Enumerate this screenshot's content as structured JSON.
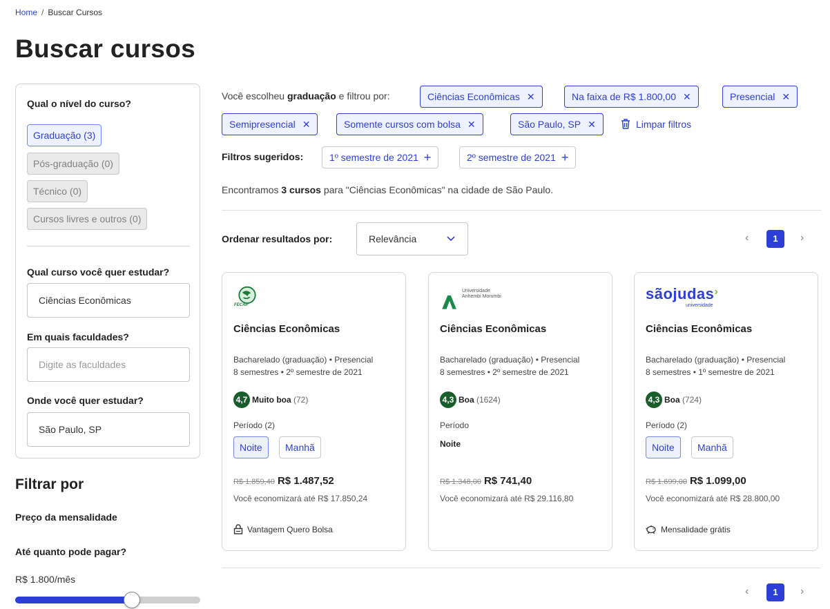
{
  "breadcrumb": {
    "home": "Home",
    "sep": "/",
    "current": "Buscar Cursos"
  },
  "page_title": "Buscar cursos",
  "sidebar": {
    "level_question": "Qual o nível do curso?",
    "levels": [
      {
        "label": "Graduação (3)",
        "active": true
      },
      {
        "label": "Pós-graduação (0)",
        "active": false
      },
      {
        "label": "Técnico (0)",
        "active": false
      },
      {
        "label": "Cursos livres e outros (0)",
        "active": false
      }
    ],
    "course_question": "Qual curso você quer estudar?",
    "course_value": "Ciências Econômicas",
    "faculty_question": "Em quais faculdades?",
    "faculty_placeholder": "Digite as faculdades",
    "location_question": "Onde você quer estudar?",
    "location_value": "São Paulo, SP"
  },
  "filters": {
    "title": "Filtrar por",
    "price_title": "Preço da mensalidade",
    "price_question": "Até quanto pode pagar?",
    "price_value": "R$ 1.800/mês",
    "price_slider_fraction": 0.63
  },
  "summary": {
    "prefix": "Você escolheu ",
    "level": "graduação",
    "suffix": " e filtrou por:",
    "chips": [
      "Ciências Econômicas",
      "Na faixa de R$ 1.800,00",
      "Presencial",
      "Semipresencial",
      "Somente cursos com bolsa",
      "São Paulo, SP"
    ],
    "clear_label": "Limpar filtros"
  },
  "suggested": {
    "label": "Filtros sugeridos:",
    "items": [
      "1º semestre de 2021",
      "2º semestre de 2021"
    ]
  },
  "found": {
    "prefix": "Encontramos ",
    "count": "3 cursos",
    "suffix": " para \"Ciências Econômicas\" na cidade de São Paulo."
  },
  "sort": {
    "label": "Ordenar resultados por:",
    "value": "Relevância"
  },
  "pagination": {
    "current": "1",
    "prev": "‹",
    "next": "›"
  },
  "cards": [
    {
      "logo": "fecap-logo",
      "logo_text": "FECAP",
      "name": "Ciências Econômicas",
      "desc1": "Bacharelado (graduação) • Presencial",
      "desc2": "8 semestres • 2º semestre de 2021",
      "score": "4,7",
      "rating_label": "Muito boa",
      "rating_count": "(72)",
      "period_label": "Período (2)",
      "periods": [
        "Noite",
        "Manhã"
      ],
      "old_price": "R$ 1.859,40",
      "price": "R$ 1.487,52",
      "savings": "Você economizará até R$ 17.850,24",
      "perk": "Vantagem Quero Bolsa",
      "perk_icon": "lock-icon"
    },
    {
      "logo": "anhembi-logo",
      "logo_text1": "Universidade",
      "logo_text2": "Anhembi Morumbi",
      "name": "Ciências Econômicas",
      "desc1": "Bacharelado (graduação) • Presencial",
      "desc2": "8 semestres • 2º semestre de 2021",
      "score": "4,3",
      "rating_label": "Boa",
      "rating_count": "(1624)",
      "period_label": "Período",
      "period_static": "Noite",
      "old_price": "R$ 1.348,00",
      "price": "R$ 741,40",
      "savings": "Você economizará até R$ 29.116,80"
    },
    {
      "logo": "saojudas-logo",
      "logo_text1": "sãojudas",
      "logo_text2": "universidade",
      "name": "Ciências Econômicas",
      "desc1": "Bacharelado (graduação) • Presencial",
      "desc2": "8 semestres • 1º semestre de 2021",
      "score": "4,3",
      "rating_label": "Boa",
      "rating_count": "(724)",
      "period_label": "Período (2)",
      "periods": [
        "Noite",
        "Manhã"
      ],
      "old_price": "R$ 1.699,00",
      "price": "R$ 1.099,00",
      "savings": "Você economizará até R$ 28.800,00",
      "perk": "Mensalidade grátis",
      "perk_icon": "piggy-bank-icon"
    }
  ],
  "colors": {
    "accent": "#2d3fd6",
    "accent_bg": "#eef2ff",
    "rating_badge": "#1a5d2c"
  }
}
